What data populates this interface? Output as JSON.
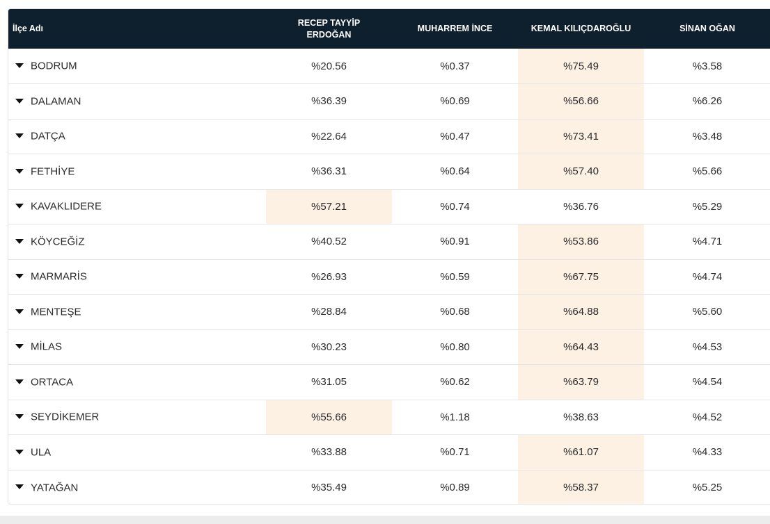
{
  "table": {
    "headers": {
      "district": "İlçe Adı",
      "candidates": [
        "RECEP TAYYİP ERDOĞAN",
        "MUHARREM İNCE",
        "KEMAL KILIÇDAROĞLU",
        "SİNAN OĞAN"
      ]
    },
    "rows": [
      {
        "name": "BODRUM",
        "values": [
          "%20.56",
          "%0.37",
          "%75.49",
          "%3.58"
        ],
        "winner": 2
      },
      {
        "name": "DALAMAN",
        "values": [
          "%36.39",
          "%0.69",
          "%56.66",
          "%6.26"
        ],
        "winner": 2
      },
      {
        "name": "DATÇA",
        "values": [
          "%22.64",
          "%0.47",
          "%73.41",
          "%3.48"
        ],
        "winner": 2
      },
      {
        "name": "FETHİYE",
        "values": [
          "%36.31",
          "%0.64",
          "%57.40",
          "%5.66"
        ],
        "winner": 2
      },
      {
        "name": "KAVAKLIDERE",
        "values": [
          "%57.21",
          "%0.74",
          "%36.76",
          "%5.29"
        ],
        "winner": 0
      },
      {
        "name": "KÖYCEĞİZ",
        "values": [
          "%40.52",
          "%0.91",
          "%53.86",
          "%4.71"
        ],
        "winner": 2
      },
      {
        "name": "MARMARİS",
        "values": [
          "%26.93",
          "%0.59",
          "%67.75",
          "%4.74"
        ],
        "winner": 2
      },
      {
        "name": "MENTEŞE",
        "values": [
          "%28.84",
          "%0.68",
          "%64.88",
          "%5.60"
        ],
        "winner": 2
      },
      {
        "name": "MİLAS",
        "values": [
          "%30.23",
          "%0.80",
          "%64.43",
          "%4.53"
        ],
        "winner": 2
      },
      {
        "name": "ORTACA",
        "values": [
          "%31.05",
          "%0.62",
          "%63.79",
          "%4.54"
        ],
        "winner": 2
      },
      {
        "name": "SEYDİKEMER",
        "values": [
          "%55.66",
          "%1.18",
          "%38.63",
          "%4.52"
        ],
        "winner": 0
      },
      {
        "name": "ULA",
        "values": [
          "%33.88",
          "%0.71",
          "%61.07",
          "%4.33"
        ],
        "winner": 2
      },
      {
        "name": "YATAĞAN",
        "values": [
          "%35.49",
          "%0.89",
          "%58.37",
          "%5.25"
        ],
        "winner": 2
      }
    ],
    "row_icon": "caret-down-icon"
  },
  "colors": {
    "header_bg": "#0e1f2e",
    "header_text": "#ffffff",
    "winner_highlight": "#fdf1e4",
    "row_divider": "#e6e6e6"
  }
}
